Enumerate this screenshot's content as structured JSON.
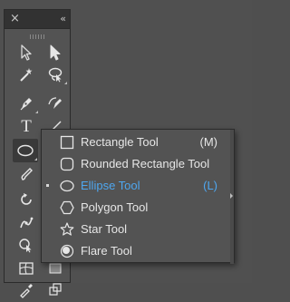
{
  "toolbar": {
    "close_glyph": "×",
    "collapse_glyph": "‹‹",
    "tools": [
      {
        "name": "selection-tool",
        "icon": "selection-arrow-icon"
      },
      {
        "name": "direct-selection-tool",
        "icon": "direct-selection-arrow-icon"
      },
      {
        "name": "magic-wand-tool",
        "icon": "magic-wand-icon"
      },
      {
        "name": "lasso-tool",
        "icon": "lasso-icon"
      },
      {
        "name": "pen-tool",
        "icon": "pen-icon"
      },
      {
        "name": "curvature-tool",
        "icon": "curvature-pen-icon"
      },
      {
        "name": "type-tool",
        "icon": "type-icon",
        "glyph": "T"
      },
      {
        "name": "line-segment-tool",
        "icon": "line-segment-icon"
      },
      {
        "name": "ellipse-tool",
        "icon": "ellipse-icon",
        "selected": true
      },
      {
        "name": "paintbrush-tool",
        "icon": "paintbrush-icon"
      },
      {
        "name": "rotate-tool",
        "icon": "rotate-icon"
      },
      {
        "name": "puppet-warp-tool",
        "icon": "puppet-warp-icon"
      },
      {
        "name": "shape-builder-tool",
        "icon": "shape-builder-icon"
      },
      {
        "name": "mesh-tool",
        "icon": "mesh-icon"
      },
      {
        "name": "eyedropper-tool",
        "icon": "eyedropper-icon"
      }
    ]
  },
  "flyout": {
    "items": [
      {
        "label": "Rectangle Tool",
        "shortcut": "(M)",
        "icon": "rectangle-icon",
        "active": false
      },
      {
        "label": "Rounded Rectangle Tool",
        "shortcut": "",
        "icon": "rounded-rectangle-icon",
        "active": false
      },
      {
        "label": "Ellipse Tool",
        "shortcut": "(L)",
        "icon": "ellipse-icon",
        "active": true
      },
      {
        "label": "Polygon Tool",
        "shortcut": "",
        "icon": "polygon-icon",
        "active": false
      },
      {
        "label": "Star Tool",
        "shortcut": "",
        "icon": "star-icon",
        "active": false
      },
      {
        "label": "Flare Tool",
        "shortcut": "",
        "icon": "flare-icon",
        "active": false
      }
    ]
  },
  "colors": {
    "panel_bg": "#535353",
    "header_bg": "#323232",
    "active_text": "#4ea7f0",
    "text": "#e6e6e6"
  }
}
